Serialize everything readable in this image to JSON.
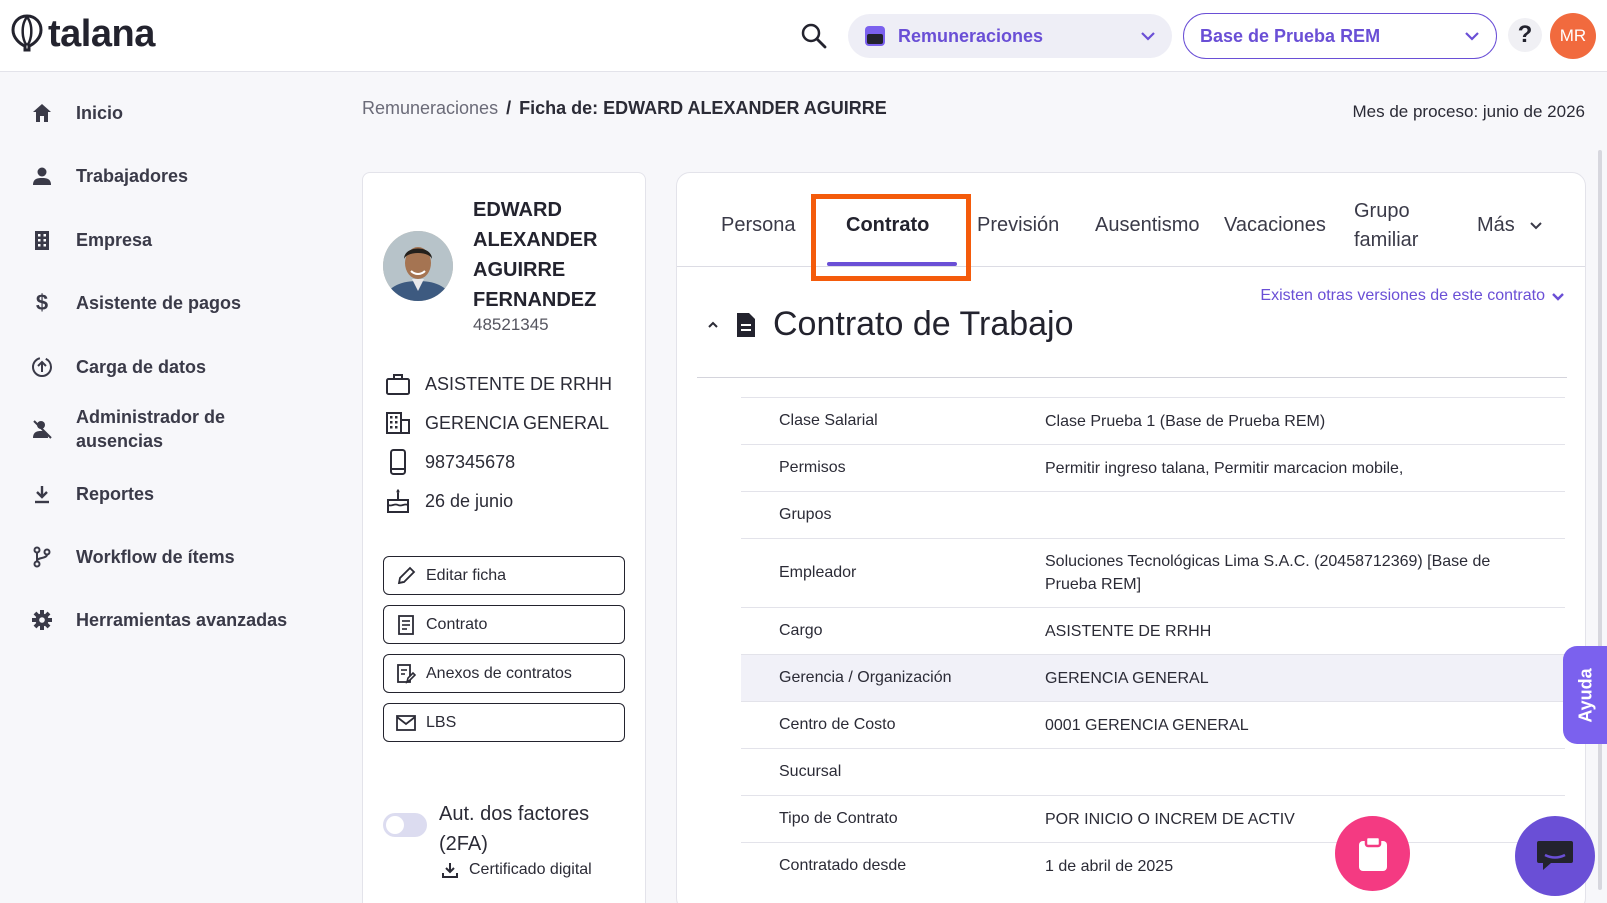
{
  "header": {
    "logo_text": "talana",
    "module": "Remuneraciones",
    "company": "Base de Prueba REM",
    "help": "?",
    "avatar_initials": "MR"
  },
  "sidebar": {
    "items": [
      {
        "label": "Inicio",
        "icon": "home-icon"
      },
      {
        "label": "Trabajadores",
        "icon": "person-icon"
      },
      {
        "label": "Empresa",
        "icon": "building-icon"
      },
      {
        "label": "Asistente de pagos",
        "icon": "dollar-icon"
      },
      {
        "label": "Carga de datos",
        "icon": "upload-icon"
      },
      {
        "label": "Administrador de ausencias",
        "icon": "absence-icon"
      },
      {
        "label": "Reportes",
        "icon": "download-icon"
      },
      {
        "label": "Workflow de ítems",
        "icon": "workflow-icon"
      },
      {
        "label": "Herramientas avanzadas",
        "icon": "gear-icon"
      }
    ]
  },
  "breadcrumb": {
    "parent": "Remuneraciones",
    "separator": "/",
    "current": "Ficha de: EDWARD ALEXANDER AGUIRRE"
  },
  "process_month": "Mes de proceso: junio de 2026",
  "profile": {
    "name": "EDWARD ALEXANDER AGUIRRE FERNANDEZ",
    "id": "48521345",
    "position": "ASISTENTE DE RRHH",
    "department": "GERENCIA GENERAL",
    "phone": "987345678",
    "birthday": "26 de junio",
    "buttons": {
      "edit": "Editar ficha",
      "contract": "Contrato",
      "annexes": "Anexos de contratos",
      "lbs": "LBS"
    },
    "twofa_label": "Aut. dos factores (2FA)",
    "cert_label": "Certificado digital"
  },
  "tabs": {
    "persona": "Persona",
    "contrato": "Contrato",
    "prevision": "Previsión",
    "ausentismo": "Ausentismo",
    "vacaciones": "Vacaciones",
    "grupo_familiar": "Grupo familiar",
    "mas": "Más"
  },
  "contract": {
    "versions_link": "Existen otras versiones de este contrato",
    "title": "Contrato de Trabajo",
    "rows": [
      {
        "label": "Clase Salarial",
        "value": "Clase Prueba 1 (Base de Prueba REM)"
      },
      {
        "label": "Permisos",
        "value": "Permitir ingreso talana, Permitir marcacion mobile,"
      },
      {
        "label": "Grupos",
        "value": ""
      },
      {
        "label": "Empleador",
        "value": "Soluciones Tecnológicas Lima S.A.C. (20458712369) [Base de Prueba REM]"
      },
      {
        "label": "Cargo",
        "value": "ASISTENTE DE RRHH"
      },
      {
        "label": "Gerencia / Organización",
        "value": "GERENCIA GENERAL"
      },
      {
        "label": "Centro de Costo",
        "value": "0001 GERENCIA GENERAL"
      },
      {
        "label": "Sucursal",
        "value": ""
      },
      {
        "label": "Tipo de Contrato",
        "value": "POR INICIO O INCREM DE ACTIV"
      },
      {
        "label": "Contratado desde",
        "value": "1 de abril de 2025"
      }
    ]
  },
  "floating": {
    "ayuda": "Ayuda"
  },
  "colors": {
    "accent": "#6a4fd6",
    "highlight": "#f45b0b",
    "avatar": "#f16a3e",
    "fab_pink": "#f43a82"
  }
}
